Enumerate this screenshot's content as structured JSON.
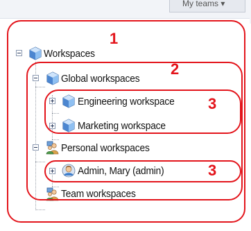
{
  "top_bar": {
    "button_label": "My teams ▾"
  },
  "tree": {
    "root": {
      "label": "Workspaces",
      "icon": "workspace-cube-icon"
    },
    "global": {
      "label": "Global workspaces",
      "icon": "workspace-cube-icon"
    },
    "engineering": {
      "label": "Engineering workspace",
      "icon": "workspace-cube-icon"
    },
    "marketing": {
      "label": "Marketing workspace",
      "icon": "workspace-cube-icon"
    },
    "personal": {
      "label": "Personal workspaces",
      "icon": "personal-users-icon"
    },
    "admin": {
      "label": "Admin, Mary (admin)",
      "icon": "user-avatar-icon"
    },
    "team": {
      "label": "Team workspaces",
      "icon": "team-users-icon"
    }
  },
  "annotations": {
    "level_1": "1",
    "level_2": "2",
    "level_3a": "3",
    "level_3b": "3"
  },
  "colors": {
    "annotation_red": "#e3141b",
    "cube_blue": "#3f7fcc"
  }
}
